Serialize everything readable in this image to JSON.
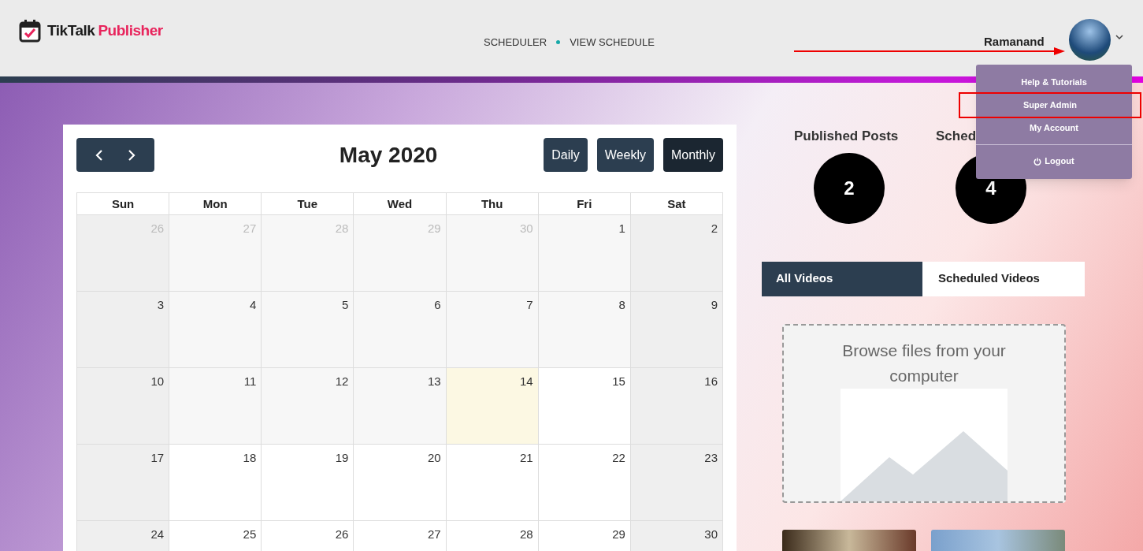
{
  "brand": {
    "name": "TikTalk",
    "accent": "Publisher"
  },
  "nav": [
    {
      "label": "SCHEDULER"
    },
    {
      "label": "VIEW SCHEDULE"
    }
  ],
  "user": {
    "name": "Ramanand",
    "menu_open": true
  },
  "user_menu": [
    {
      "label": "Help & Tutorials",
      "kind": "link",
      "highlighted": false
    },
    {
      "label": "Super Admin",
      "kind": "link",
      "highlighted": true
    },
    {
      "label": "My Account",
      "kind": "link",
      "highlighted": false
    },
    {
      "label": "Logout",
      "kind": "logout",
      "highlighted": false
    }
  ],
  "calendar": {
    "title": "May 2020",
    "views": [
      {
        "label": "Daily",
        "selected": false
      },
      {
        "label": "Weekly",
        "selected": false
      },
      {
        "label": "Monthly",
        "selected": true
      }
    ],
    "weekdays": [
      "Sun",
      "Mon",
      "Tue",
      "Wed",
      "Thu",
      "Fri",
      "Sat"
    ],
    "weeks": [
      [
        {
          "day": "26",
          "kind": "weekend",
          "other_month": true
        },
        {
          "day": "27",
          "kind": "past",
          "other_month": true
        },
        {
          "day": "28",
          "kind": "past",
          "other_month": true
        },
        {
          "day": "29",
          "kind": "past",
          "other_month": true
        },
        {
          "day": "30",
          "kind": "past",
          "other_month": true
        },
        {
          "day": "1",
          "kind": "past",
          "other_month": false
        },
        {
          "day": "2",
          "kind": "weekend",
          "other_month": false
        }
      ],
      [
        {
          "day": "3",
          "kind": "weekend",
          "other_month": false
        },
        {
          "day": "4",
          "kind": "past",
          "other_month": false
        },
        {
          "day": "5",
          "kind": "past",
          "other_month": false
        },
        {
          "day": "6",
          "kind": "past",
          "other_month": false
        },
        {
          "day": "7",
          "kind": "past",
          "other_month": false
        },
        {
          "day": "8",
          "kind": "past",
          "other_month": false
        },
        {
          "day": "9",
          "kind": "weekend",
          "other_month": false
        }
      ],
      [
        {
          "day": "10",
          "kind": "weekend",
          "other_month": false
        },
        {
          "day": "11",
          "kind": "past",
          "other_month": false
        },
        {
          "day": "12",
          "kind": "past",
          "other_month": false
        },
        {
          "day": "13",
          "kind": "past",
          "other_month": false
        },
        {
          "day": "14",
          "kind": "today",
          "other_month": false
        },
        {
          "day": "15",
          "kind": "future",
          "other_month": false
        },
        {
          "day": "16",
          "kind": "weekend",
          "other_month": false
        }
      ],
      [
        {
          "day": "17",
          "kind": "weekend",
          "other_month": false
        },
        {
          "day": "18",
          "kind": "future",
          "other_month": false
        },
        {
          "day": "19",
          "kind": "future",
          "other_month": false
        },
        {
          "day": "20",
          "kind": "future",
          "other_month": false
        },
        {
          "day": "21",
          "kind": "future",
          "other_month": false
        },
        {
          "day": "22",
          "kind": "future",
          "other_month": false
        },
        {
          "day": "23",
          "kind": "weekend",
          "other_month": false
        }
      ],
      [
        {
          "day": "24",
          "kind": "weekend",
          "other_month": false
        },
        {
          "day": "25",
          "kind": "future",
          "other_month": false
        },
        {
          "day": "26",
          "kind": "future",
          "other_month": false
        },
        {
          "day": "27",
          "kind": "future",
          "other_month": false
        },
        {
          "day": "28",
          "kind": "future",
          "other_month": false
        },
        {
          "day": "29",
          "kind": "future",
          "other_month": false
        },
        {
          "day": "30",
          "kind": "weekend",
          "other_month": false
        }
      ]
    ]
  },
  "stats": [
    {
      "label": "Published Posts",
      "value": "2"
    },
    {
      "label": "Sched",
      "value": "4"
    }
  ],
  "video_tabs": [
    {
      "label": "All Videos",
      "selected": true
    },
    {
      "label": "Scheduled Videos",
      "selected": false
    }
  ],
  "upload": {
    "text": "Browse files from your computer"
  },
  "thumbnails": [
    {
      "kind": "dark"
    },
    {
      "kind": "sky"
    }
  ]
}
